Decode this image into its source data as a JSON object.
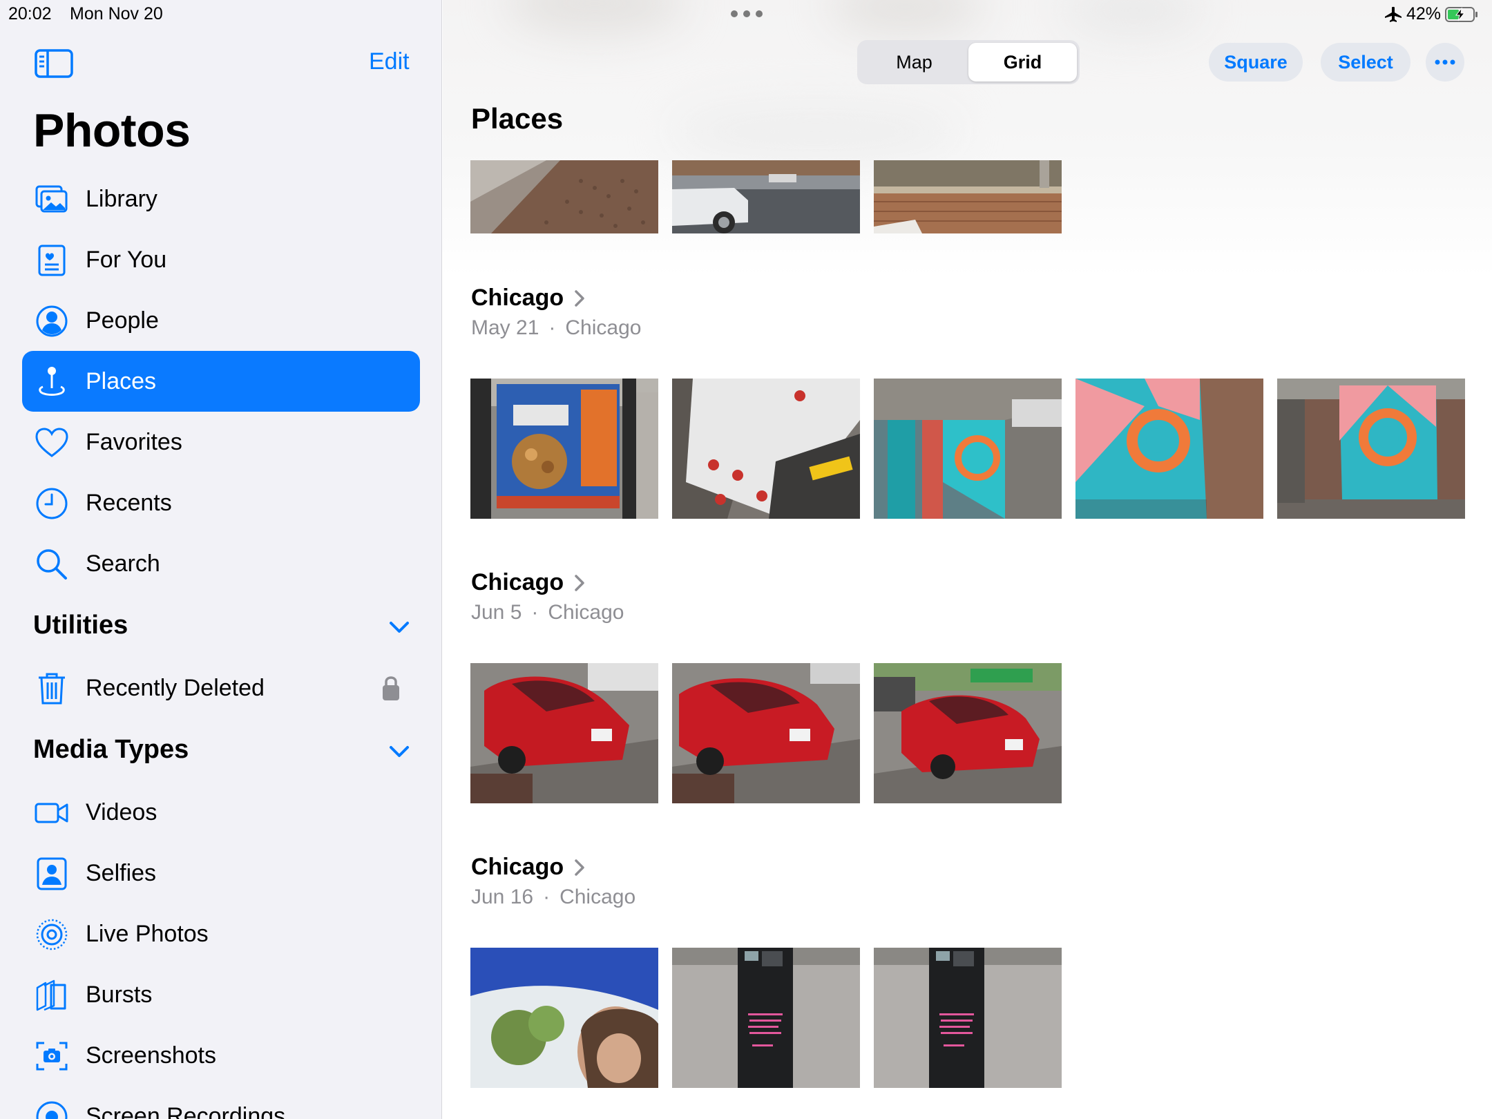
{
  "status": {
    "time": "20:02",
    "date": "Mon Nov 20",
    "battery": "42%"
  },
  "sidebar": {
    "edit_label": "Edit",
    "title": "Photos",
    "items": [
      {
        "label": "Library",
        "icon": "library-icon"
      },
      {
        "label": "For You",
        "icon": "for-you-icon"
      },
      {
        "label": "People",
        "icon": "people-icon"
      },
      {
        "label": "Places",
        "icon": "places-icon",
        "active": true
      },
      {
        "label": "Favorites",
        "icon": "heart-icon"
      },
      {
        "label": "Recents",
        "icon": "clock-icon"
      },
      {
        "label": "Search",
        "icon": "search-icon"
      }
    ],
    "utilities": {
      "header": "Utilities",
      "items": [
        {
          "label": "Recently Deleted",
          "icon": "trash-icon",
          "locked": true
        }
      ]
    },
    "media_types": {
      "header": "Media Types",
      "items": [
        {
          "label": "Videos",
          "icon": "video-icon"
        },
        {
          "label": "Selfies",
          "icon": "selfie-icon"
        },
        {
          "label": "Live Photos",
          "icon": "live-photos-icon"
        },
        {
          "label": "Bursts",
          "icon": "bursts-icon"
        },
        {
          "label": "Screenshots",
          "icon": "screenshot-icon"
        },
        {
          "label": "Screen Recordings",
          "icon": "screen-recording-icon"
        }
      ]
    }
  },
  "main": {
    "segments": [
      {
        "label": "Map"
      },
      {
        "label": "Grid",
        "selected": true
      }
    ],
    "buttons": {
      "square": "Square",
      "select": "Select"
    },
    "title": "Places",
    "groups": [
      {
        "title": "Chicago",
        "date": "May 21",
        "place": "Chicago",
        "photo_count": 5
      },
      {
        "title": "Chicago",
        "date": "Jun 5",
        "place": "Chicago",
        "photo_count": 3
      },
      {
        "title": "Chicago",
        "date": "Jun 16",
        "place": "Chicago",
        "photo_count": 3
      }
    ]
  },
  "colors": {
    "accent": "#007aff",
    "sidebar_bg": "#f2f2f7",
    "active_bg": "#0a7aff",
    "secondary_text": "#8e8e93"
  }
}
